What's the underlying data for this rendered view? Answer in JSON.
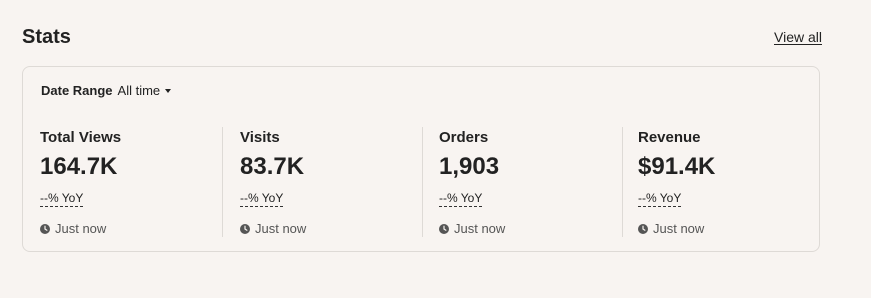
{
  "header": {
    "title": "Stats",
    "view_all": "View all"
  },
  "date_range": {
    "label": "Date Range",
    "value": "All time"
  },
  "stats": [
    {
      "label": "Total Views",
      "value": "164.7K",
      "yoy": "--% YoY",
      "time": "Just now"
    },
    {
      "label": "Visits",
      "value": "83.7K",
      "yoy": "--% YoY",
      "time": "Just now"
    },
    {
      "label": "Orders",
      "value": "1,903",
      "yoy": "--% YoY",
      "time": "Just now"
    },
    {
      "label": "Revenue",
      "value": "$91.4K",
      "yoy": "--% YoY",
      "time": "Just now"
    }
  ],
  "icons": {
    "caret": "caret-down-icon",
    "clock": "clock-icon"
  },
  "colors": {
    "background": "#f8f4f1",
    "text": "#222222",
    "muted": "#555555",
    "border": "#dedad6"
  }
}
